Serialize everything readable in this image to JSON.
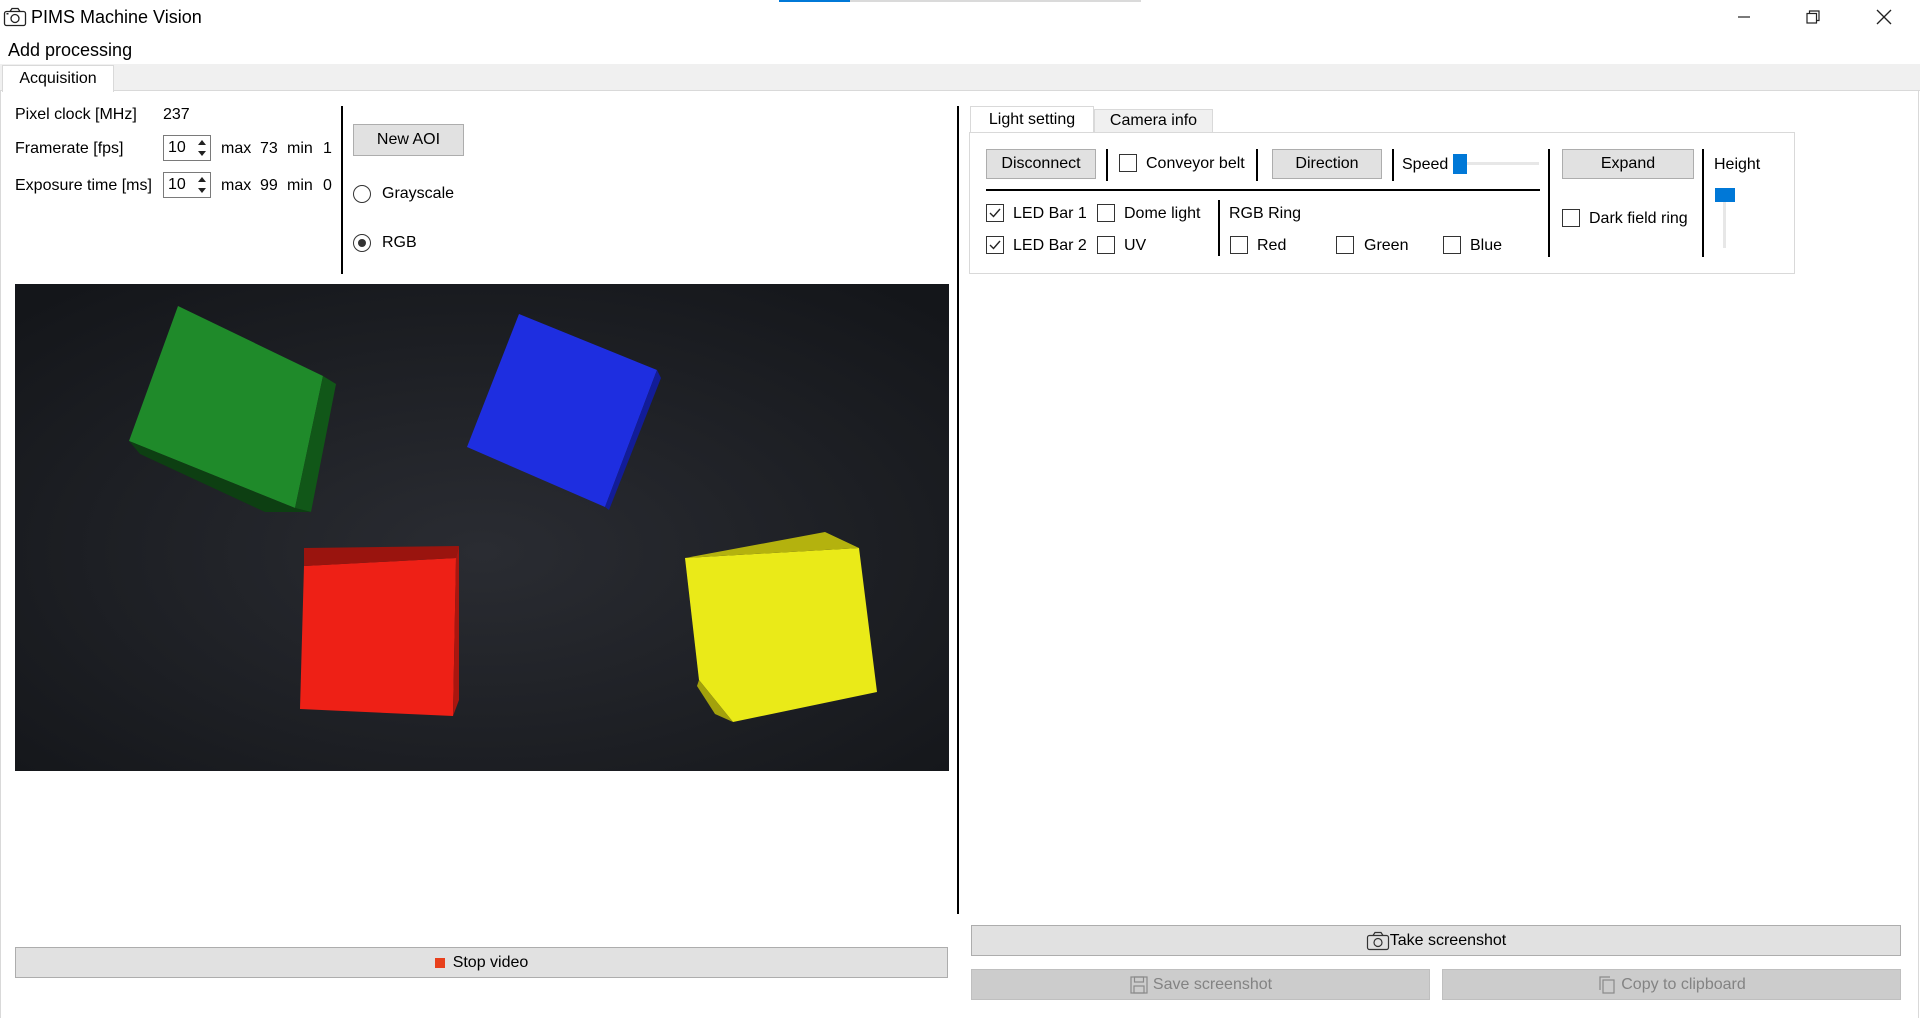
{
  "window": {
    "title": "PIMS Machine Vision"
  },
  "menu": {
    "add_processing": "Add processing"
  },
  "tabs": {
    "acquisition": "Acquisition"
  },
  "acquisition": {
    "pixel_clock_label": "Pixel clock [MHz]",
    "pixel_clock_value": "237",
    "framerate_label": "Framerate [fps]",
    "framerate_value": "10",
    "framerate_max_label": "max",
    "framerate_max": "73",
    "framerate_min_label": "min",
    "framerate_min": "1",
    "exposure_label": "Exposure time [ms]",
    "exposure_value": "10",
    "exposure_max_label": "max",
    "exposure_max": "99",
    "exposure_min_label": "min",
    "exposure_min": "0",
    "new_aoi": "New AOI",
    "grayscale": "Grayscale",
    "rgb": "RGB",
    "color_mode_selected": "RGB",
    "stop_video": "Stop video",
    "stop_icon_color": "#e8401c"
  },
  "right_tabs": {
    "light_setting": "Light setting",
    "camera_info": "Camera info",
    "active": "Light setting"
  },
  "light": {
    "disconnect": "Disconnect",
    "conveyor_belt": "Conveyor belt",
    "conveyor_belt_checked": false,
    "direction": "Direction",
    "speed": "Speed",
    "speed_level": 0.0,
    "expand": "Expand",
    "height": "Height",
    "height_level": 1.0,
    "led_bar_1": "LED Bar 1",
    "led_bar_1_checked": true,
    "led_bar_2": "LED Bar 2",
    "led_bar_2_checked": true,
    "dome_light": "Dome light",
    "dome_light_checked": false,
    "uv": "UV",
    "uv_checked": false,
    "rgb_ring": "RGB Ring",
    "red": "Red",
    "red_checked": false,
    "green": "Green",
    "green_checked": false,
    "blue": "Blue",
    "blue_checked": false,
    "dark_field_ring": "Dark field ring",
    "dark_field_ring_checked": false,
    "slider_color": "#0078d7"
  },
  "screenshot": {
    "take": "Take screenshot",
    "save": "Save screenshot",
    "copy": "Copy to clipboard"
  }
}
